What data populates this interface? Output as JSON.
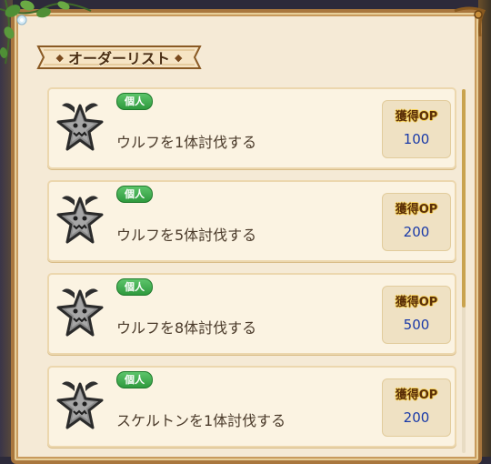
{
  "header": {
    "title": "オーダーリスト",
    "deco_left": "◆",
    "deco_right": "◆"
  },
  "orders": [
    {
      "badge": "個人",
      "title": "ウルフを1体討伐する",
      "op_label": "獲得OP",
      "op_value": "100",
      "icon": "wolf-star-icon"
    },
    {
      "badge": "個人",
      "title": "ウルフを5体討伐する",
      "op_label": "獲得OP",
      "op_value": "200",
      "icon": "wolf-star-icon"
    },
    {
      "badge": "個人",
      "title": "ウルフを8体討伐する",
      "op_label": "獲得OP",
      "op_value": "500",
      "icon": "wolf-star-icon"
    },
    {
      "badge": "個人",
      "title": "スケルトンを1体討伐する",
      "op_label": "獲得OP",
      "op_value": "200",
      "icon": "skeleton-star-icon"
    }
  ],
  "colors": {
    "panel": "#f5ead6",
    "frame": "#a9773e",
    "badge": "#2f9a3e",
    "op_value": "#1a3aa8"
  },
  "scroll": {
    "position": 0,
    "visible_fraction": 0.6
  }
}
